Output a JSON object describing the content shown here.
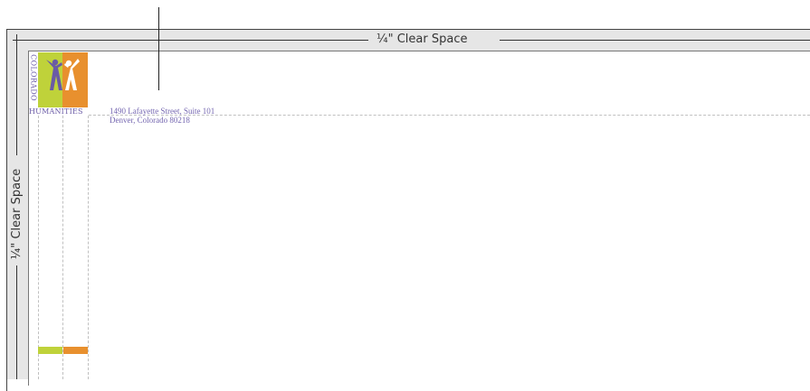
{
  "clear_space": {
    "top_label": "¼\" Clear Space",
    "left_label": "¼\" Clear Space"
  },
  "logo": {
    "side_text": "COLORADO",
    "bottom_text": "HUMANITIES",
    "colors": {
      "lime": "#bfd23a",
      "orange": "#e8902e",
      "purple": "#6a5aa6"
    }
  },
  "address": {
    "line1": "1490 Lafayette Street, Suite 101",
    "line2": "Denver, Colorado 80218"
  },
  "colors": {
    "band": "#e6e6e6",
    "guide": "#c0c0c0"
  }
}
